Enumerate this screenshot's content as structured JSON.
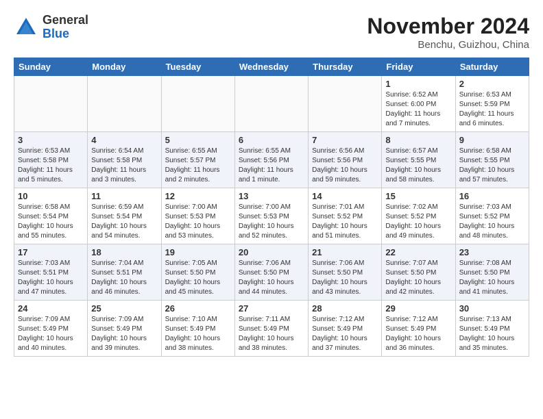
{
  "logo": {
    "general": "General",
    "blue": "Blue"
  },
  "header": {
    "month": "November 2024",
    "location": "Benchu, Guizhou, China"
  },
  "weekdays": [
    "Sunday",
    "Monday",
    "Tuesday",
    "Wednesday",
    "Thursday",
    "Friday",
    "Saturday"
  ],
  "weeks": [
    [
      {
        "day": "",
        "info": ""
      },
      {
        "day": "",
        "info": ""
      },
      {
        "day": "",
        "info": ""
      },
      {
        "day": "",
        "info": ""
      },
      {
        "day": "",
        "info": ""
      },
      {
        "day": "1",
        "info": "Sunrise: 6:52 AM\nSunset: 6:00 PM\nDaylight: 11 hours\nand 7 minutes."
      },
      {
        "day": "2",
        "info": "Sunrise: 6:53 AM\nSunset: 5:59 PM\nDaylight: 11 hours\nand 6 minutes."
      }
    ],
    [
      {
        "day": "3",
        "info": "Sunrise: 6:53 AM\nSunset: 5:58 PM\nDaylight: 11 hours\nand 5 minutes."
      },
      {
        "day": "4",
        "info": "Sunrise: 6:54 AM\nSunset: 5:58 PM\nDaylight: 11 hours\nand 3 minutes."
      },
      {
        "day": "5",
        "info": "Sunrise: 6:55 AM\nSunset: 5:57 PM\nDaylight: 11 hours\nand 2 minutes."
      },
      {
        "day": "6",
        "info": "Sunrise: 6:55 AM\nSunset: 5:56 PM\nDaylight: 11 hours\nand 1 minute."
      },
      {
        "day": "7",
        "info": "Sunrise: 6:56 AM\nSunset: 5:56 PM\nDaylight: 10 hours\nand 59 minutes."
      },
      {
        "day": "8",
        "info": "Sunrise: 6:57 AM\nSunset: 5:55 PM\nDaylight: 10 hours\nand 58 minutes."
      },
      {
        "day": "9",
        "info": "Sunrise: 6:58 AM\nSunset: 5:55 PM\nDaylight: 10 hours\nand 57 minutes."
      }
    ],
    [
      {
        "day": "10",
        "info": "Sunrise: 6:58 AM\nSunset: 5:54 PM\nDaylight: 10 hours\nand 55 minutes."
      },
      {
        "day": "11",
        "info": "Sunrise: 6:59 AM\nSunset: 5:54 PM\nDaylight: 10 hours\nand 54 minutes."
      },
      {
        "day": "12",
        "info": "Sunrise: 7:00 AM\nSunset: 5:53 PM\nDaylight: 10 hours\nand 53 minutes."
      },
      {
        "day": "13",
        "info": "Sunrise: 7:00 AM\nSunset: 5:53 PM\nDaylight: 10 hours\nand 52 minutes."
      },
      {
        "day": "14",
        "info": "Sunrise: 7:01 AM\nSunset: 5:52 PM\nDaylight: 10 hours\nand 51 minutes."
      },
      {
        "day": "15",
        "info": "Sunrise: 7:02 AM\nSunset: 5:52 PM\nDaylight: 10 hours\nand 49 minutes."
      },
      {
        "day": "16",
        "info": "Sunrise: 7:03 AM\nSunset: 5:52 PM\nDaylight: 10 hours\nand 48 minutes."
      }
    ],
    [
      {
        "day": "17",
        "info": "Sunrise: 7:03 AM\nSunset: 5:51 PM\nDaylight: 10 hours\nand 47 minutes."
      },
      {
        "day": "18",
        "info": "Sunrise: 7:04 AM\nSunset: 5:51 PM\nDaylight: 10 hours\nand 46 minutes."
      },
      {
        "day": "19",
        "info": "Sunrise: 7:05 AM\nSunset: 5:50 PM\nDaylight: 10 hours\nand 45 minutes."
      },
      {
        "day": "20",
        "info": "Sunrise: 7:06 AM\nSunset: 5:50 PM\nDaylight: 10 hours\nand 44 minutes."
      },
      {
        "day": "21",
        "info": "Sunrise: 7:06 AM\nSunset: 5:50 PM\nDaylight: 10 hours\nand 43 minutes."
      },
      {
        "day": "22",
        "info": "Sunrise: 7:07 AM\nSunset: 5:50 PM\nDaylight: 10 hours\nand 42 minutes."
      },
      {
        "day": "23",
        "info": "Sunrise: 7:08 AM\nSunset: 5:50 PM\nDaylight: 10 hours\nand 41 minutes."
      }
    ],
    [
      {
        "day": "24",
        "info": "Sunrise: 7:09 AM\nSunset: 5:49 PM\nDaylight: 10 hours\nand 40 minutes."
      },
      {
        "day": "25",
        "info": "Sunrise: 7:09 AM\nSunset: 5:49 PM\nDaylight: 10 hours\nand 39 minutes."
      },
      {
        "day": "26",
        "info": "Sunrise: 7:10 AM\nSunset: 5:49 PM\nDaylight: 10 hours\nand 38 minutes."
      },
      {
        "day": "27",
        "info": "Sunrise: 7:11 AM\nSunset: 5:49 PM\nDaylight: 10 hours\nand 38 minutes."
      },
      {
        "day": "28",
        "info": "Sunrise: 7:12 AM\nSunset: 5:49 PM\nDaylight: 10 hours\nand 37 minutes."
      },
      {
        "day": "29",
        "info": "Sunrise: 7:12 AM\nSunset: 5:49 PM\nDaylight: 10 hours\nand 36 minutes."
      },
      {
        "day": "30",
        "info": "Sunrise: 7:13 AM\nSunset: 5:49 PM\nDaylight: 10 hours\nand 35 minutes."
      }
    ]
  ]
}
